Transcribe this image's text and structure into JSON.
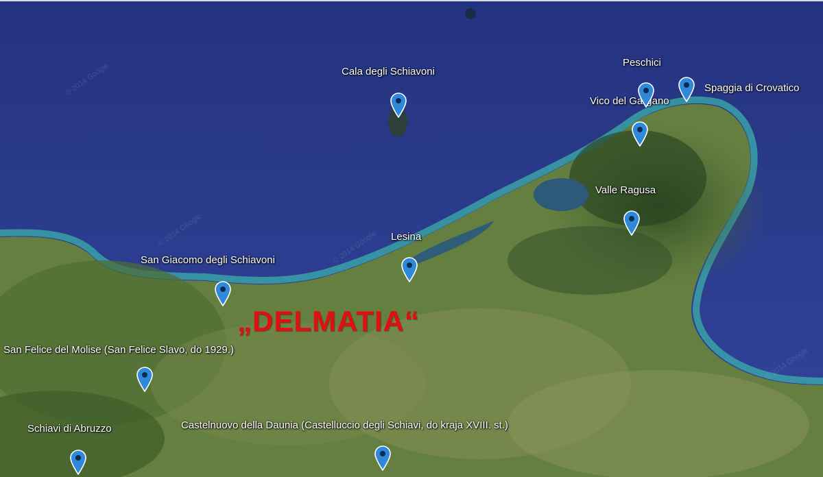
{
  "map": {
    "overlay_title": "„DELMATIA“",
    "overlay_color": "#e01010",
    "sea_color": "#2b3a8c",
    "land_color": "#5d7a3c",
    "pin_color": "#2f88d8",
    "watermarks": [
      "© 2014 Google",
      "© 2014 Google",
      "© 2014 Google",
      "© 2014 Google"
    ],
    "places": [
      {
        "id": "cala",
        "label": "Cala degli Schiavoni"
      },
      {
        "id": "peschici",
        "label": "Peschici"
      },
      {
        "id": "crovatico",
        "label": "Spaggia di Crovatico"
      },
      {
        "id": "vico",
        "label": "Vico del Gargano"
      },
      {
        "id": "valle",
        "label": "Valle Ragusa"
      },
      {
        "id": "lesina",
        "label": "Lesina"
      },
      {
        "id": "sangiacomo",
        "label": "San Giacomo degli Schiavoni"
      },
      {
        "id": "sanfelice",
        "label": "San Felice del Molise (San Felice Slavo, do 1929.)"
      },
      {
        "id": "schiavi",
        "label": "Schiavi di Abruzzo"
      },
      {
        "id": "castelnuovo",
        "label": "Castelnuovo della Daunia (Castelluccio degli Schiavi, do kraja XVIII. st.)"
      }
    ]
  }
}
